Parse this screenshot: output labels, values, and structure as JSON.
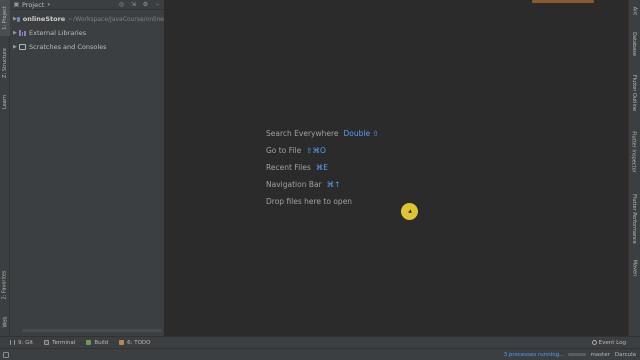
{
  "left_strip": {
    "tabs": [
      "1: Project",
      "Z: Structure",
      "Learn",
      "2: Favorites",
      "Web"
    ]
  },
  "right_strip": {
    "tabs": [
      "Ant",
      "Database",
      "Flutter Outline",
      "Flutter Inspector",
      "Flutter Performance",
      "Maven"
    ]
  },
  "project_panel": {
    "title": "Project",
    "tree": [
      {
        "name": "onlineStore",
        "path": "~/Workspace/JavaCourse/online"
      },
      {
        "name": "External Libraries"
      },
      {
        "name": "Scratches and Consoles"
      }
    ]
  },
  "editor": {
    "hints": [
      {
        "label": "Search Everywhere",
        "key": "Double ⇧"
      },
      {
        "label": "Go to File",
        "key": "⇧⌘O"
      },
      {
        "label": "Recent Files",
        "key": "⌘E"
      },
      {
        "label": "Navigation Bar",
        "key": "⌘↑"
      },
      {
        "label": "Drop files here to open",
        "key": ""
      }
    ]
  },
  "bottom_bar": {
    "tabs": [
      "9: Git",
      "Terminal",
      "Build",
      "6: TODO"
    ],
    "event_log": "Event Log"
  },
  "status_bar": {
    "processes": "3 processes running...",
    "branch": "master",
    "theme": "Darcula"
  },
  "colors": {
    "background": "#2b2b2b",
    "panel": "#3c3f41",
    "accent": "#589df6",
    "cursor": "#f2d43a"
  }
}
